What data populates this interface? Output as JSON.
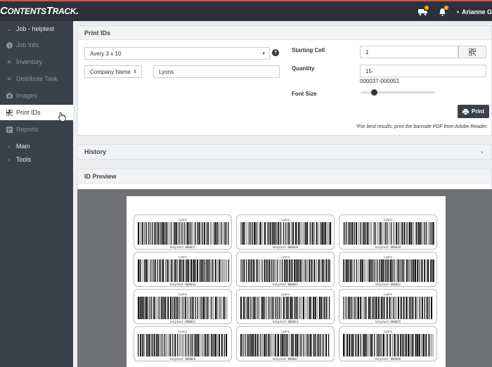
{
  "app": {
    "logo": "ContentsTrack.",
    "user_name": "Arianne G",
    "colors": {
      "topbar": "#2c3238",
      "sidebar": "#3b4148",
      "accent": "#d4524e",
      "badge": "#f5a623"
    }
  },
  "topbar": {
    "icons": [
      "truck-icon",
      "bell-icon",
      "user-icon"
    ]
  },
  "sidebar": {
    "job_header": "Job - helptest",
    "items": [
      {
        "label": "Job Info",
        "icon": "info-icon"
      },
      {
        "label": "Inventory",
        "icon": "list-icon"
      },
      {
        "label": "Distribute Task",
        "icon": "list-icon"
      },
      {
        "label": "Images",
        "icon": "camera-icon"
      },
      {
        "label": "Print IDs",
        "icon": "qr-icon",
        "active": true
      },
      {
        "label": "Reports",
        "icon": "report-icon"
      }
    ],
    "sections": [
      {
        "label": "Main"
      },
      {
        "label": "Tools"
      }
    ]
  },
  "print_ids": {
    "title": "Print IDs",
    "template_value": "Avery 3 x 10",
    "filter_field_value": "Company Name",
    "filter_text_value": "Lyons",
    "starting_cell_label": "Starting Cell",
    "starting_cell_value": "1",
    "quantity_label": "Quantity",
    "quantity_value": "15",
    "range_text": "000037-000051",
    "font_size_label": "Font Size",
    "font_size_level": 0.15,
    "print_button": "Print",
    "note": "*For best results, print the barcode PDF from Adobe Reader."
  },
  "history": {
    "title": "History"
  },
  "preview": {
    "title": "ID Preview",
    "labels": [
      {
        "top": "Lyons",
        "code": "helptest-000037"
      },
      {
        "top": "Lyons",
        "code": "helptest-000038"
      },
      {
        "top": "Lyons",
        "code": "helptest-000039"
      },
      {
        "top": "Lyons",
        "code": "helptest-000040"
      },
      {
        "top": "Lyons",
        "code": "helptest-000041"
      },
      {
        "top": "Lyons",
        "code": "helptest-000042"
      },
      {
        "top": "Lyons",
        "code": "helptest-000043"
      },
      {
        "top": "Lyons",
        "code": "helptest-000044"
      },
      {
        "top": "Lyons",
        "code": "helptest-000045"
      },
      {
        "top": "Lyons",
        "code": "helptest-000046"
      },
      {
        "top": "Lyons",
        "code": "helptest-000047"
      },
      {
        "top": "Lyons",
        "code": "helptest-000048"
      }
    ]
  }
}
